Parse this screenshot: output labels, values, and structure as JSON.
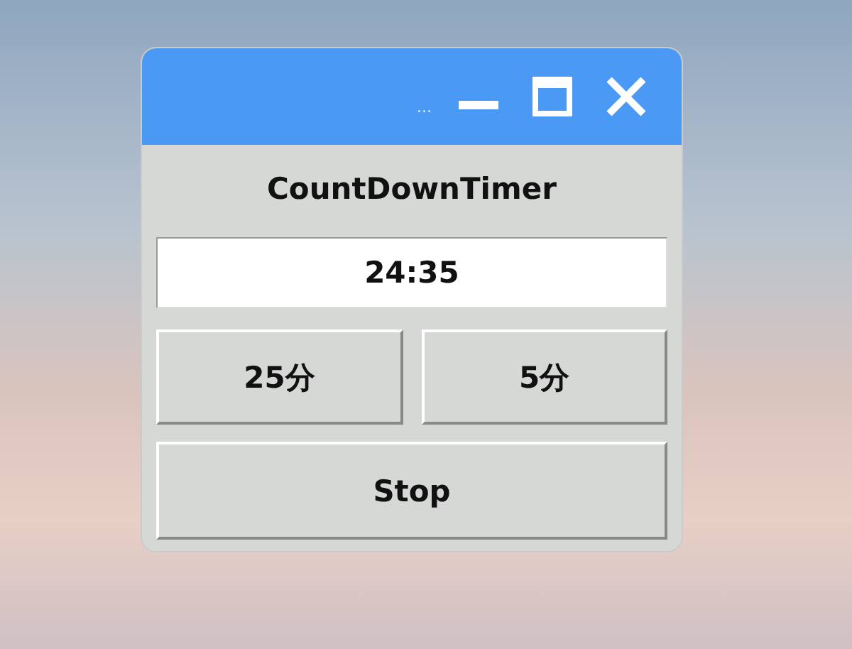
{
  "window": {
    "title": "..."
  },
  "heading": "CountDownTimer",
  "display": {
    "value": "24:35"
  },
  "preset_buttons": [
    "25分",
    "5分"
  ],
  "stop_button": "Stop"
}
